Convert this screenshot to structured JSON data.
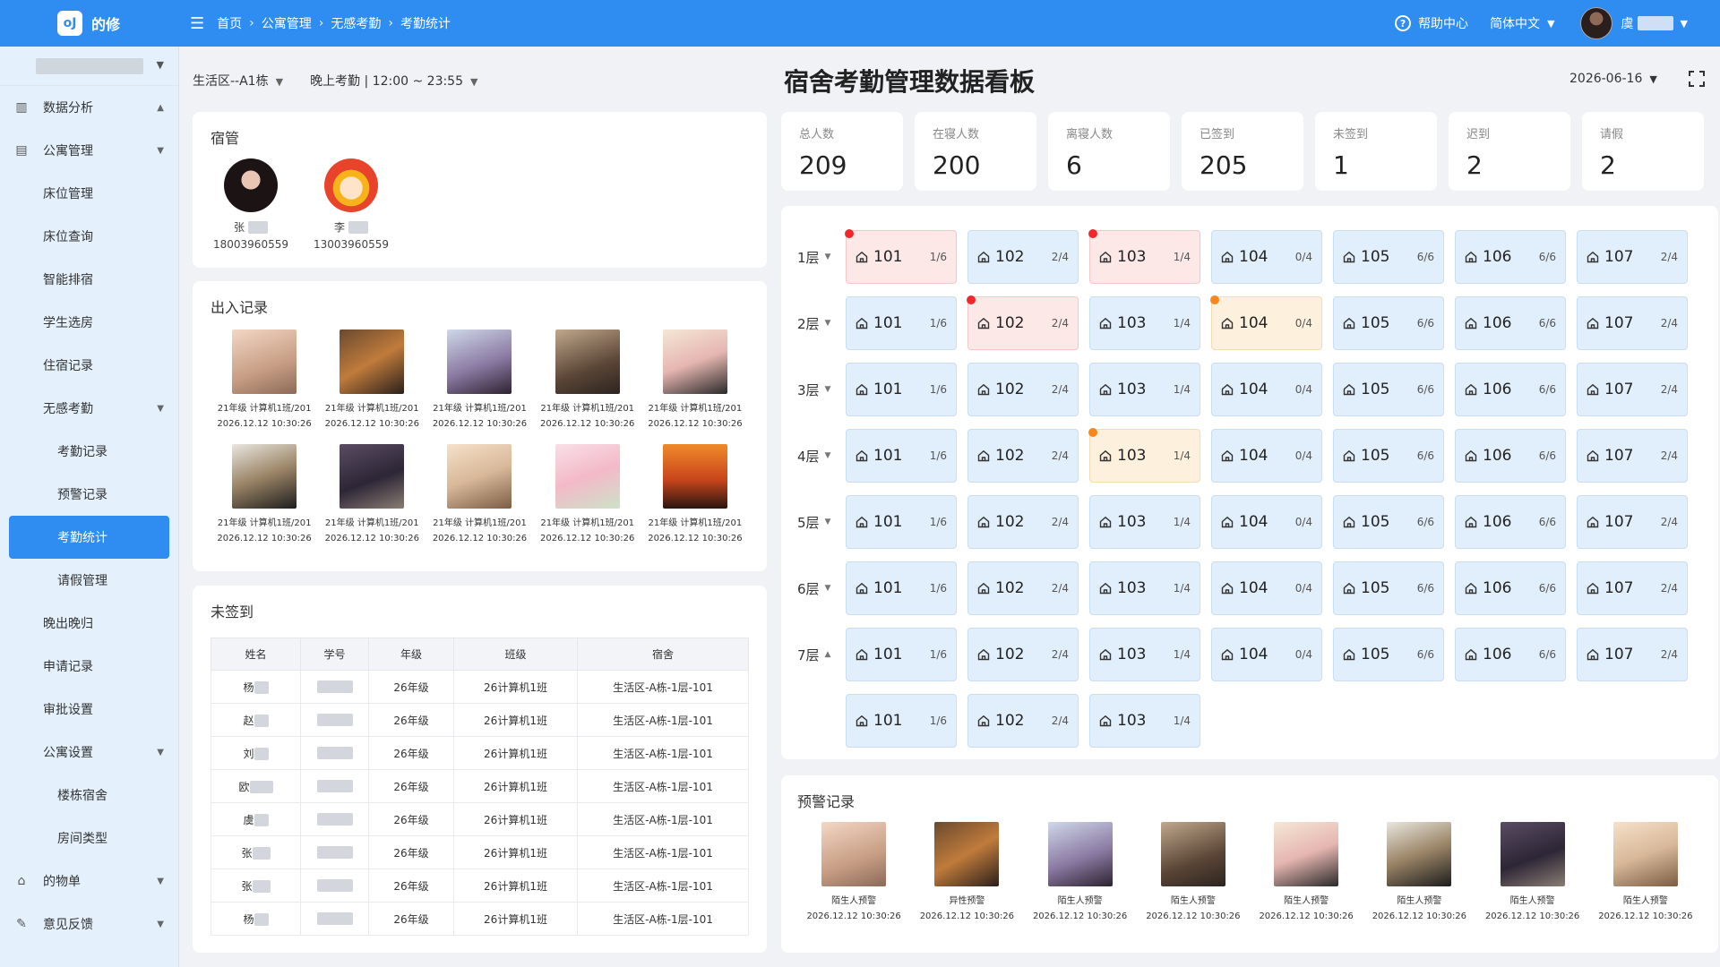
{
  "brand": {
    "logo": "oJ",
    "name": "的修"
  },
  "breadcrumb": [
    "首页",
    "公寓管理",
    "无感考勤",
    "考勤统计"
  ],
  "header": {
    "help": "帮助中心",
    "language": "简体中文",
    "user_initial": "虞"
  },
  "sidebar": {
    "items": [
      {
        "label": "数据分析",
        "icon": "chart-icon",
        "arrow": "▲"
      },
      {
        "label": "公寓管理",
        "icon": "building-icon",
        "arrow": "▼"
      },
      {
        "label": "床位管理"
      },
      {
        "label": "床位查询"
      },
      {
        "label": "智能排宿"
      },
      {
        "label": "学生选房"
      },
      {
        "label": "住宿记录"
      },
      {
        "label": "无感考勤",
        "arrow": "▼"
      },
      {
        "label": "考勤记录"
      },
      {
        "label": "预警记录"
      },
      {
        "label": "考勤统计"
      },
      {
        "label": "请假管理"
      },
      {
        "label": "晚出晚归"
      },
      {
        "label": "申请记录"
      },
      {
        "label": "审批设置"
      },
      {
        "label": "公寓设置",
        "arrow": "▼"
      },
      {
        "label": "楼栋宿舍"
      },
      {
        "label": "房间类型"
      },
      {
        "label": "的物单",
        "icon": "bag-icon",
        "arrow": "▼"
      },
      {
        "label": "意见反馈",
        "icon": "edit-icon",
        "arrow": "▼"
      }
    ]
  },
  "filters": {
    "building": "生活区--A1栋",
    "session": "晚上考勤 | 12:00 ~ 23:55"
  },
  "title": "宿舍考勤管理数据看板",
  "date": "2026-06-16",
  "managers": {
    "title": "宿管",
    "list": [
      {
        "surname": "张",
        "phone": "18003960559"
      },
      {
        "surname": "李",
        "phone": "13003960559"
      }
    ]
  },
  "access": {
    "title": "出入记录",
    "records": [
      {
        "line1": "21年级 计算机1班/201",
        "line2": "2026.12.12  10:30:26"
      },
      {
        "line1": "21年级 计算机1班/201",
        "line2": "2026.12.12  10:30:26"
      },
      {
        "line1": "21年级 计算机1班/201",
        "line2": "2026.12.12  10:30:26"
      },
      {
        "line1": "21年级 计算机1班/201",
        "line2": "2026.12.12  10:30:26"
      },
      {
        "line1": "21年级 计算机1班/201",
        "line2": "2026.12.12  10:30:26"
      },
      {
        "line1": "21年级 计算机1班/201",
        "line2": "2026.12.12  10:30:26"
      },
      {
        "line1": "21年级 计算机1班/201",
        "line2": "2026.12.12  10:30:26"
      },
      {
        "line1": "21年级 计算机1班/201",
        "line2": "2026.12.12  10:30:26"
      },
      {
        "line1": "21年级 计算机1班/201",
        "line2": "2026.12.12  10:30:26"
      },
      {
        "line1": "21年级 计算机1班/201",
        "line2": "2026.12.12  10:30:26"
      }
    ]
  },
  "unsigned": {
    "title": "未签到",
    "columns": [
      "姓名",
      "学号",
      "年级",
      "班级",
      "宿舍"
    ],
    "rows": [
      {
        "surname": "杨",
        "grade": "26年级",
        "class": "26计算机1班",
        "dorm": "生活区-A栋-1层-101"
      },
      {
        "surname": "赵",
        "grade": "26年级",
        "class": "26计算机1班",
        "dorm": "生活区-A栋-1层-101"
      },
      {
        "surname": "刘",
        "grade": "26年级",
        "class": "26计算机1班",
        "dorm": "生活区-A栋-1层-101"
      },
      {
        "surname": "欧",
        "grade": "26年级",
        "class": "26计算机1班",
        "dorm": "生活区-A栋-1层-101"
      },
      {
        "surname": "虞",
        "grade": "26年级",
        "class": "26计算机1班",
        "dorm": "生活区-A栋-1层-101"
      },
      {
        "surname": "张",
        "grade": "26年级",
        "class": "26计算机1班",
        "dorm": "生活区-A栋-1层-101"
      },
      {
        "surname": "张",
        "grade": "26年级",
        "class": "26计算机1班",
        "dorm": "生活区-A栋-1层-101"
      },
      {
        "surname": "杨",
        "grade": "26年级",
        "class": "26计算机1班",
        "dorm": "生活区-A栋-1层-101"
      }
    ]
  },
  "stats": [
    {
      "label": "总人数",
      "value": "209"
    },
    {
      "label": "在寝人数",
      "value": "200"
    },
    {
      "label": "离寝人数",
      "value": "6"
    },
    {
      "label": "已签到",
      "value": "205"
    },
    {
      "label": "未签到",
      "value": "1"
    },
    {
      "label": "迟到",
      "value": "2"
    },
    {
      "label": "请假",
      "value": "2"
    }
  ],
  "floors": [
    {
      "label": "1层",
      "arrow": "▼",
      "rooms": [
        {
          "no": "101",
          "occ": "1/6",
          "status": "red",
          "dot": "red"
        },
        {
          "no": "102",
          "occ": "2/4"
        },
        {
          "no": "103",
          "occ": "1/4",
          "status": "red",
          "dot": "red"
        },
        {
          "no": "104",
          "occ": "0/4"
        },
        {
          "no": "105",
          "occ": "6/6"
        },
        {
          "no": "106",
          "occ": "6/6"
        },
        {
          "no": "107",
          "occ": "2/4"
        }
      ]
    },
    {
      "label": "2层",
      "arrow": "▼",
      "rooms": [
        {
          "no": "101",
          "occ": "1/6"
        },
        {
          "no": "102",
          "occ": "2/4",
          "status": "red",
          "dot": "red"
        },
        {
          "no": "103",
          "occ": "1/4"
        },
        {
          "no": "104",
          "occ": "0/4",
          "status": "orange",
          "dot": "orange"
        },
        {
          "no": "105",
          "occ": "6/6"
        },
        {
          "no": "106",
          "occ": "6/6"
        },
        {
          "no": "107",
          "occ": "2/4"
        }
      ]
    },
    {
      "label": "3层",
      "arrow": "▼",
      "rooms": [
        {
          "no": "101",
          "occ": "1/6"
        },
        {
          "no": "102",
          "occ": "2/4"
        },
        {
          "no": "103",
          "occ": "1/4"
        },
        {
          "no": "104",
          "occ": "0/4"
        },
        {
          "no": "105",
          "occ": "6/6"
        },
        {
          "no": "106",
          "occ": "6/6"
        },
        {
          "no": "107",
          "occ": "2/4"
        }
      ]
    },
    {
      "label": "4层",
      "arrow": "▼",
      "rooms": [
        {
          "no": "101",
          "occ": "1/6"
        },
        {
          "no": "102",
          "occ": "2/4"
        },
        {
          "no": "103",
          "occ": "1/4",
          "status": "orange",
          "dot": "orange"
        },
        {
          "no": "104",
          "occ": "0/4"
        },
        {
          "no": "105",
          "occ": "6/6"
        },
        {
          "no": "106",
          "occ": "6/6"
        },
        {
          "no": "107",
          "occ": "2/4"
        }
      ]
    },
    {
      "label": "5层",
      "arrow": "▼",
      "rooms": [
        {
          "no": "101",
          "occ": "1/6"
        },
        {
          "no": "102",
          "occ": "2/4"
        },
        {
          "no": "103",
          "occ": "1/4"
        },
        {
          "no": "104",
          "occ": "0/4"
        },
        {
          "no": "105",
          "occ": "6/6"
        },
        {
          "no": "106",
          "occ": "6/6"
        },
        {
          "no": "107",
          "occ": "2/4"
        }
      ]
    },
    {
      "label": "6层",
      "arrow": "▼",
      "rooms": [
        {
          "no": "101",
          "occ": "1/6"
        },
        {
          "no": "102",
          "occ": "2/4"
        },
        {
          "no": "103",
          "occ": "1/4"
        },
        {
          "no": "104",
          "occ": "0/4"
        },
        {
          "no": "105",
          "occ": "6/6"
        },
        {
          "no": "106",
          "occ": "6/6"
        },
        {
          "no": "107",
          "occ": "2/4"
        }
      ]
    },
    {
      "label": "7层",
      "arrow": "▲",
      "rooms": [
        {
          "no": "101",
          "occ": "1/6"
        },
        {
          "no": "102",
          "occ": "2/4"
        },
        {
          "no": "103",
          "occ": "1/4"
        },
        {
          "no": "104",
          "occ": "0/4"
        },
        {
          "no": "105",
          "occ": "6/6"
        },
        {
          "no": "106",
          "occ": "6/6"
        },
        {
          "no": "107",
          "occ": "2/4"
        }
      ]
    },
    {
      "label": "",
      "arrow": "",
      "rooms": [
        {
          "no": "101",
          "occ": "1/6"
        },
        {
          "no": "102",
          "occ": "2/4"
        },
        {
          "no": "103",
          "occ": "1/4"
        }
      ]
    }
  ],
  "warnings": {
    "title": "预警记录",
    "records": [
      {
        "type": "陌生人预警",
        "time": "2026.12.12  10:30:26"
      },
      {
        "type": "异性预警",
        "time": "2026.12.12  10:30:26"
      },
      {
        "type": "陌生人预警",
        "time": "2026.12.12  10:30:26"
      },
      {
        "type": "陌生人预警",
        "time": "2026.12.12  10:30:26"
      },
      {
        "type": "陌生人预警",
        "time": "2026.12.12  10:30:26"
      },
      {
        "type": "陌生人预警",
        "time": "2026.12.12  10:30:26"
      },
      {
        "type": "陌生人预警",
        "time": "2026.12.12  10:30:26"
      },
      {
        "type": "陌生人预警",
        "time": "2026.12.12  10:30:26"
      }
    ]
  },
  "colors": {
    "primary": "#2f8cf0",
    "room_normal": "#e1eefb",
    "room_alert": "#fde8e8",
    "room_warn": "#fdf0dc",
    "dot_red": "#f0272a",
    "dot_orange": "#f7861b"
  }
}
